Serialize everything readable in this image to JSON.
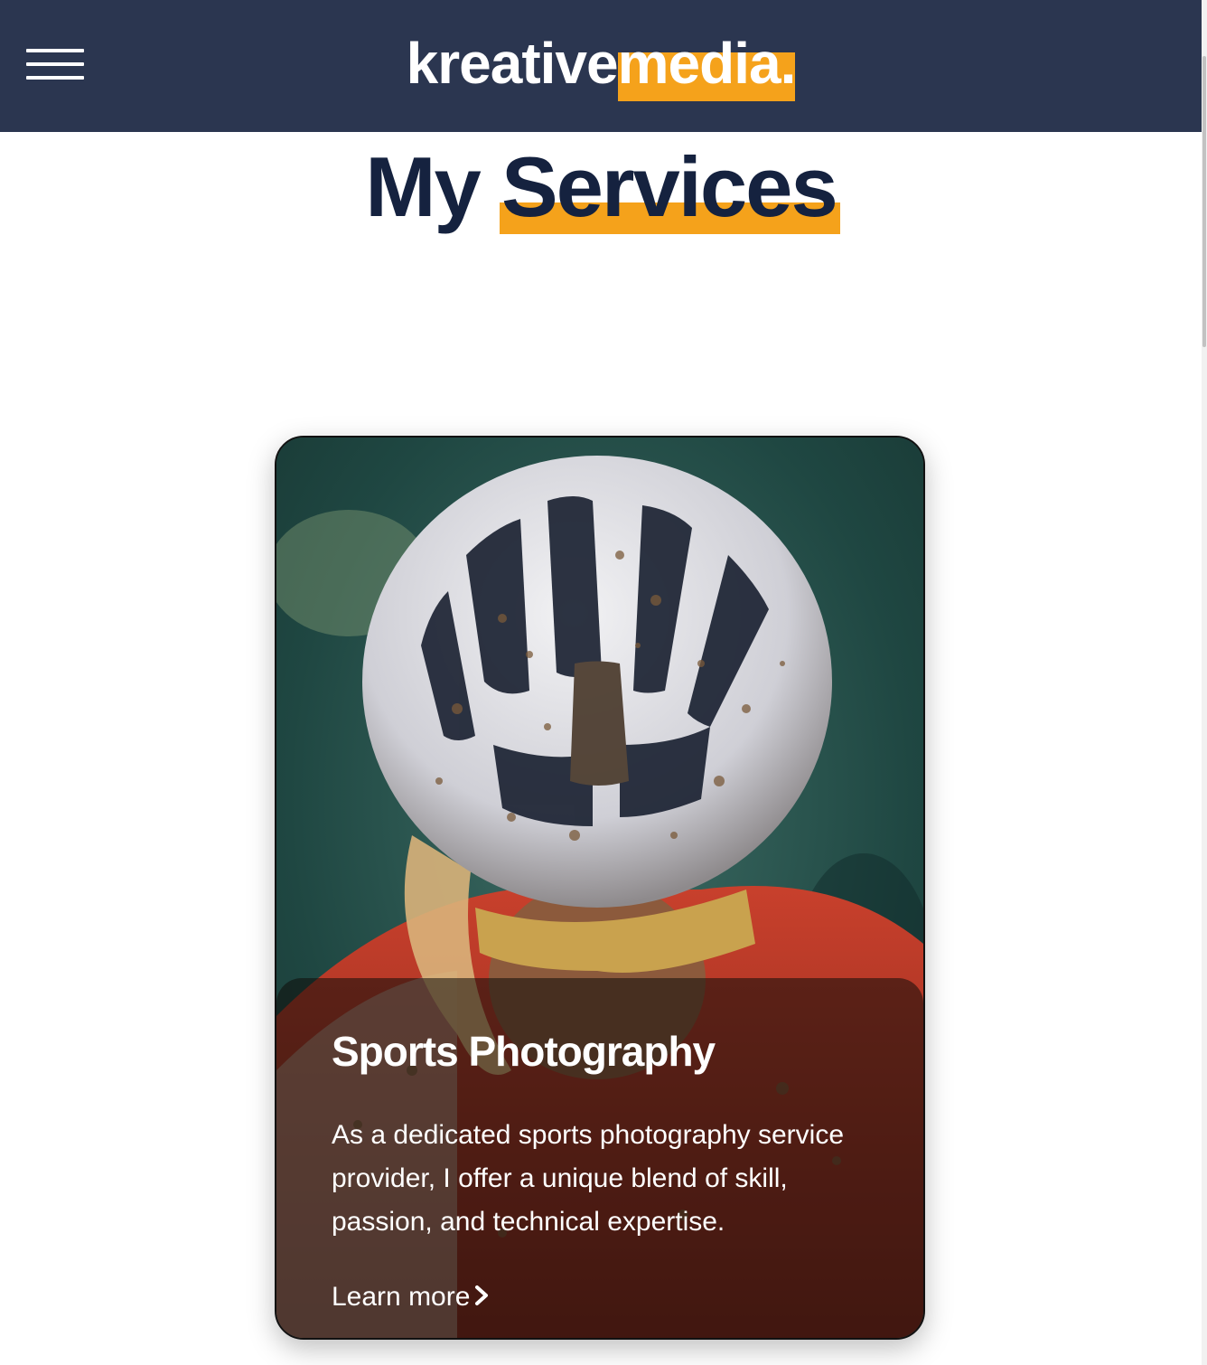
{
  "header": {
    "menu_icon": "hamburger-menu-icon",
    "logo_main": "kreative",
    "logo_accent": "media."
  },
  "section": {
    "title_plain": "My",
    "title_accent": "Services"
  },
  "card": {
    "image_subject": "cyclist-in-muddy-helmet",
    "title": "Sports Photography",
    "description": "As a dedicated sports photography service provider, I offer a unique blend of skill, passion, and technical expertise.",
    "link_label": "Learn more",
    "link_icon": "chevron-right-icon"
  },
  "colors": {
    "header_bg": "#2b3650",
    "accent": "#f5a21b",
    "title_text": "#15223f",
    "text_light": "#ffffff"
  }
}
